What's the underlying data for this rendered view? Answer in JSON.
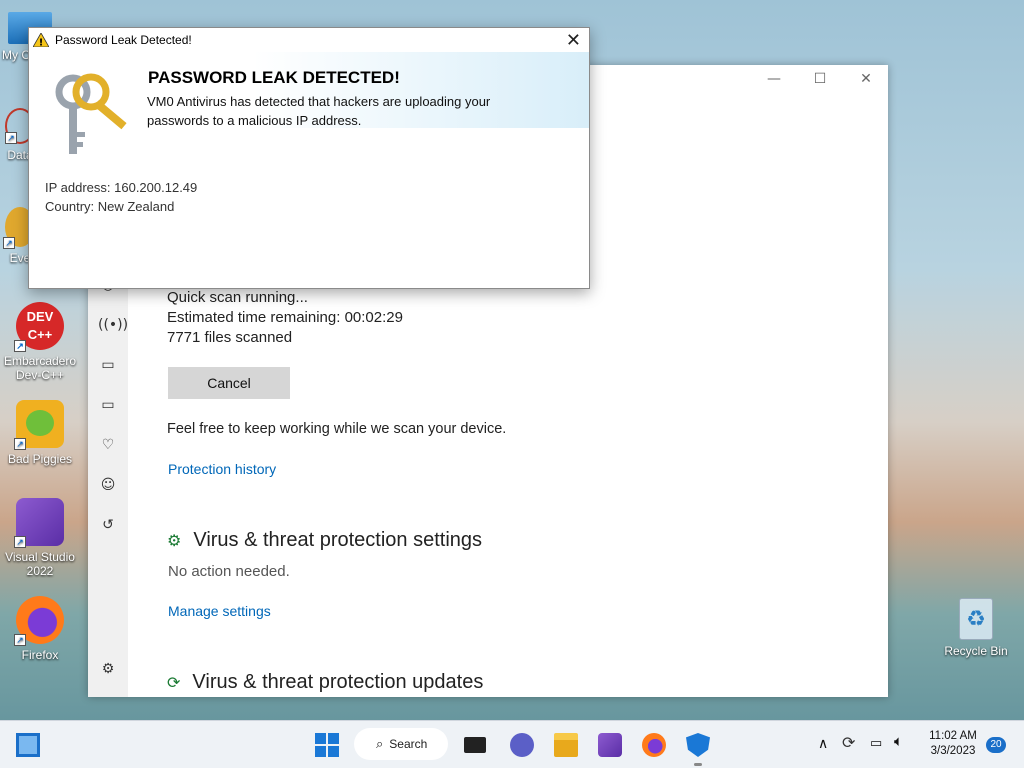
{
  "desktop": {
    "icons": [
      {
        "label": "My C"
      },
      {
        "label": "Data"
      },
      {
        "label": "Eve"
      },
      {
        "label": "Embarcadero Dev-C++",
        "badge": "DEV C++"
      },
      {
        "label": "Bad Piggies"
      },
      {
        "label": "Visual Studio 2022"
      },
      {
        "label": "Firefox"
      },
      {
        "label": "Recycle Bin"
      }
    ]
  },
  "security_window": {
    "scan_status": "Quick scan running...",
    "time_remaining_label": "Estimated time remaining:",
    "time_remaining_value": "00:02:29",
    "files_scanned": "7771 files scanned",
    "cancel_label": "Cancel",
    "keep_working": "Feel free to keep working while we scan your device.",
    "protection_history": "Protection history",
    "settings_title": "Virus & threat protection settings",
    "settings_status": "No action needed.",
    "manage_settings": "Manage settings",
    "updates_title": "Virus & threat protection updates"
  },
  "dialog": {
    "title": "Password Leak Detected!",
    "heading": "PASSWORD LEAK DETECTED!",
    "message": "VM0 Antivirus has detected that hackers are uploading your passwords to a malicious IP address.",
    "ip_line": "IP address: 160.200.12.49",
    "country_line": "Country: New Zealand"
  },
  "taskbar": {
    "search_label": "Search",
    "time": "11:02 AM",
    "date": "3/3/2023",
    "notification_count": "20"
  },
  "colors": {
    "link": "#0067b8",
    "accent": "#0078d4"
  }
}
